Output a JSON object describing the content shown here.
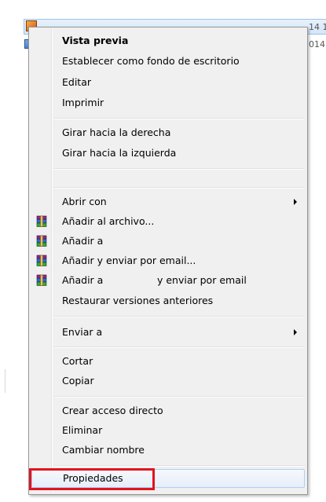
{
  "background": {
    "file_name": "[...]",
    "date_1": "14 1",
    "date_2": "014 1"
  },
  "menu": {
    "items": [
      {
        "label": "Vista previa",
        "bold": true
      },
      {
        "label": "Establecer como fondo de escritorio"
      },
      {
        "label": "Editar"
      },
      {
        "label": "Imprimir"
      },
      {
        "label": "Girar hacia la derecha"
      },
      {
        "label": "Girar hacia la izquierda"
      },
      {
        "label": "Abrir con",
        "submenu": true
      },
      {
        "label": "Añadir al archivo...",
        "icon": "winrar-icon"
      },
      {
        "label": "Añadir a",
        "icon": "winrar-icon"
      },
      {
        "label": "Añadir y enviar por email...",
        "icon": "winrar-icon"
      },
      {
        "label": "Añadir a",
        "suffix": "y enviar por email",
        "icon": "winrar-icon"
      },
      {
        "label": "Restaurar versiones anteriores"
      },
      {
        "label": "Enviar a",
        "submenu": true
      },
      {
        "label": "Cortar"
      },
      {
        "label": "Copiar"
      },
      {
        "label": "Crear acceso directo"
      },
      {
        "label": "Eliminar"
      },
      {
        "label": "Cambiar nombre"
      },
      {
        "label": "Propiedades"
      }
    ]
  },
  "colors": {
    "highlight": "#e2141f",
    "menu_bg": "#f0f0f0"
  }
}
